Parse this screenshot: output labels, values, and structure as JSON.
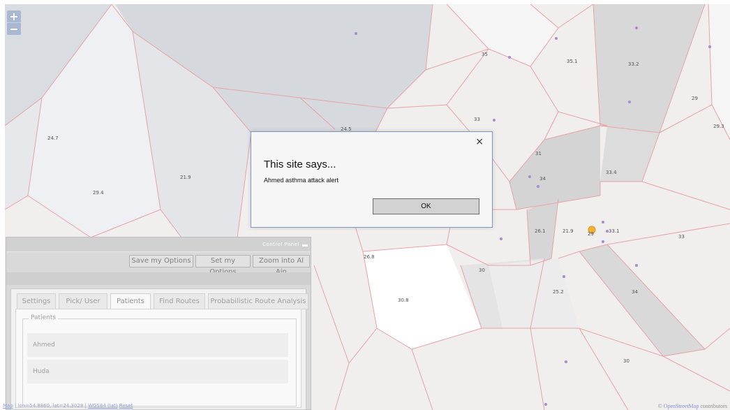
{
  "map": {
    "zoom_in": "+",
    "zoom_out": "−",
    "cell_labels": [
      "24.7",
      "29.4",
      "21.9",
      "24.5",
      "33",
      "35",
      "35.1",
      "33.2",
      "29",
      "29.3",
      "31",
      "34",
      "33.4",
      "26.1",
      "21.9",
      "29",
      "33",
      "26.8",
      "30",
      "30.8",
      "25.2",
      "34",
      "30",
      "33.1"
    ]
  },
  "control_panel": {
    "title": "Control Panel",
    "buttons": [
      "Save my Options",
      "Set my Options",
      "Zoom into Al Ain"
    ],
    "tabs": [
      "Settings",
      "Pick/ User",
      "Patients",
      "Find Routes",
      "Probabilistic Route Analysis"
    ],
    "active_tab": "Patients",
    "patients_legend": "Patients",
    "patients": [
      "Ahmed",
      "Huda"
    ]
  },
  "status_bar": {
    "map_link": "Map",
    "coords": "| lon=54.8860, lat=24.3028 |",
    "link1": "WGS84 (lat)",
    "link2": "Reset"
  },
  "attribution": {
    "prefix": "© ",
    "link": "OpenStreetMap",
    "suffix": " contributors"
  },
  "dialog": {
    "close": "×",
    "title": "This site says...",
    "message": "Ahmed asthma attack alert",
    "ok": "OK"
  },
  "colors": {
    "cell_border": "#e8a2a8",
    "point": "#a98ad0",
    "marker": "#f2b431",
    "dialog_border": "#7e95c8"
  }
}
